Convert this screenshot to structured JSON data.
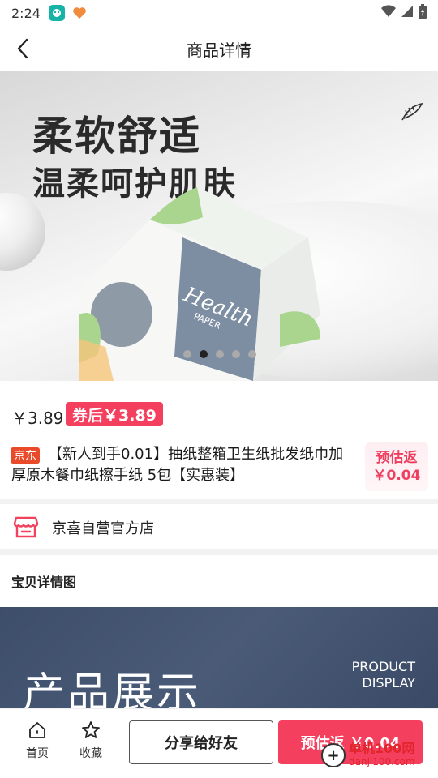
{
  "status_bar": {
    "time": "2:24",
    "icons": [
      "app-badge-teal-icon",
      "app-badge-heart-icon",
      "wifi-icon",
      "cellular-signal-icon",
      "battery-charging-icon"
    ]
  },
  "nav": {
    "title": "商品详情",
    "back_icon": "chevron-left-icon"
  },
  "banner": {
    "headline": "柔软舒适",
    "subheadline": "温柔呵护肌肤",
    "package_brand": "Health",
    "package_word": "PAPER",
    "carousel": {
      "count": 5,
      "active_index": 1
    }
  },
  "product": {
    "price": "￥3.89",
    "coupon_price": "券后￥3.89",
    "platform_tag": "京东",
    "title": "【新人到手0.01】抽纸整箱卫生纸批发纸巾加厚原木餐巾纸擦手纸 5包【实惠装】",
    "rebate_label": "预估返",
    "rebate_value": "￥0.04"
  },
  "shop": {
    "name": "京喜自营官方店",
    "icon": "storefront-icon"
  },
  "details": {
    "title": "宝贝详情图",
    "image_heading_cn": "产品展示",
    "image_heading_en_1": "PRODUCT",
    "image_heading_en_2": "DISPLAY"
  },
  "bottom_bar": {
    "home_label": "首页",
    "favorite_label": "收藏",
    "share_label": "分享给好友",
    "rebate_button_label": "预估返 ￥0.04"
  },
  "watermark": {
    "symbol": "+",
    "site_name": "单机100网",
    "site_url": "danji100.com"
  },
  "colors": {
    "accent": "#f43f5e",
    "jd_tag": "#e94a2a",
    "display_background": "#3d4e6b"
  }
}
